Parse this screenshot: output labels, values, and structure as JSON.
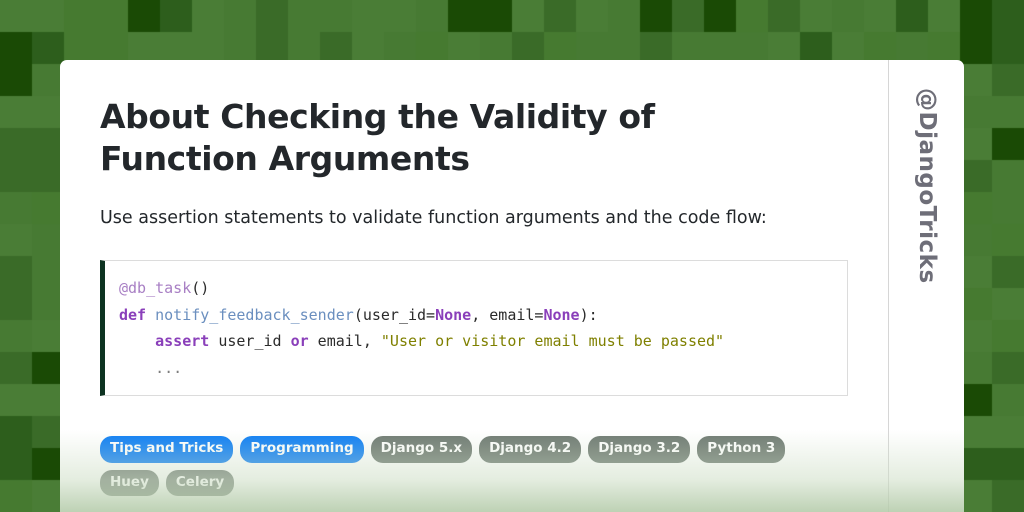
{
  "page": {
    "background_colors": [
      "#477a33",
      "#4a7d36",
      "#3a6b28",
      "#1a4a05",
      "#2d5e1c",
      "#467a30"
    ],
    "card_background": "#ffffff",
    "accent_blue": "#0d7ef5",
    "accent_gray": "#6f7a72",
    "code_accent": "#0d3321"
  },
  "article": {
    "title": "About Checking the Validity of Function Arguments",
    "lede": "Use assertion statements to validate function arguments and the code flow:"
  },
  "code_block": {
    "language": "python",
    "lines": [
      [
        {
          "t": "@db_task",
          "c": "tok-dec"
        },
        {
          "t": "()",
          "c": "tok-plain"
        }
      ],
      [
        {
          "t": "def",
          "c": "tok-kw"
        },
        {
          "t": " ",
          "c": "tok-plain"
        },
        {
          "t": "notify_feedback_sender",
          "c": "tok-fn"
        },
        {
          "t": "(user_id=",
          "c": "tok-plain"
        },
        {
          "t": "None",
          "c": "tok-kw"
        },
        {
          "t": ", email=",
          "c": "tok-plain"
        },
        {
          "t": "None",
          "c": "tok-kw"
        },
        {
          "t": "):",
          "c": "tok-plain"
        }
      ],
      [
        {
          "t": "    ",
          "c": "tok-plain"
        },
        {
          "t": "assert",
          "c": "tok-kw"
        },
        {
          "t": " user_id ",
          "c": "tok-plain"
        },
        {
          "t": "or",
          "c": "tok-kw"
        },
        {
          "t": " email, ",
          "c": "tok-plain"
        },
        {
          "t": "\"User or visitor email must be passed\"",
          "c": "tok-str"
        }
      ],
      [
        {
          "t": "    ",
          "c": "tok-plain"
        },
        {
          "t": "...",
          "c": "tok-dots"
        }
      ]
    ]
  },
  "tags": [
    {
      "label": "Tips and Tricks",
      "style": "primary"
    },
    {
      "label": "Programming",
      "style": "primary"
    },
    {
      "label": "Django 5.x",
      "style": "secondary"
    },
    {
      "label": "Django 4.2",
      "style": "secondary"
    },
    {
      "label": "Django 3.2",
      "style": "secondary"
    },
    {
      "label": "Python 3",
      "style": "secondary"
    },
    {
      "label": "Huey",
      "style": "secondary"
    },
    {
      "label": "Celery",
      "style": "secondary"
    }
  ],
  "sidebar": {
    "handle": "@DjangoTricks"
  }
}
